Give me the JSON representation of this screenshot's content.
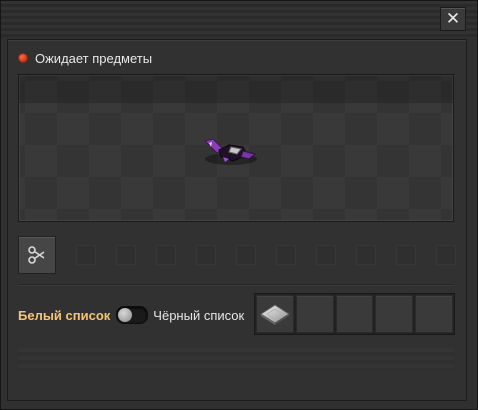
{
  "window": {
    "close_label": "✕",
    "status_text": "Ожидает предметы",
    "status_color": "#d42000"
  },
  "preview": {
    "entity_icon": "filter-inserter-icon"
  },
  "filter": {
    "mode_icon": "filter-icon",
    "ghost_slot_count": 10
  },
  "mode": {
    "whitelist_label": "Белый список",
    "blacklist_label": "Чёрный список",
    "whitelist_color": "#f5c47a",
    "toggle_state": "whitelist"
  },
  "filter_slots": {
    "count": 5,
    "filled": [
      {
        "index": 0,
        "icon": "concrete-plate-icon"
      }
    ]
  }
}
